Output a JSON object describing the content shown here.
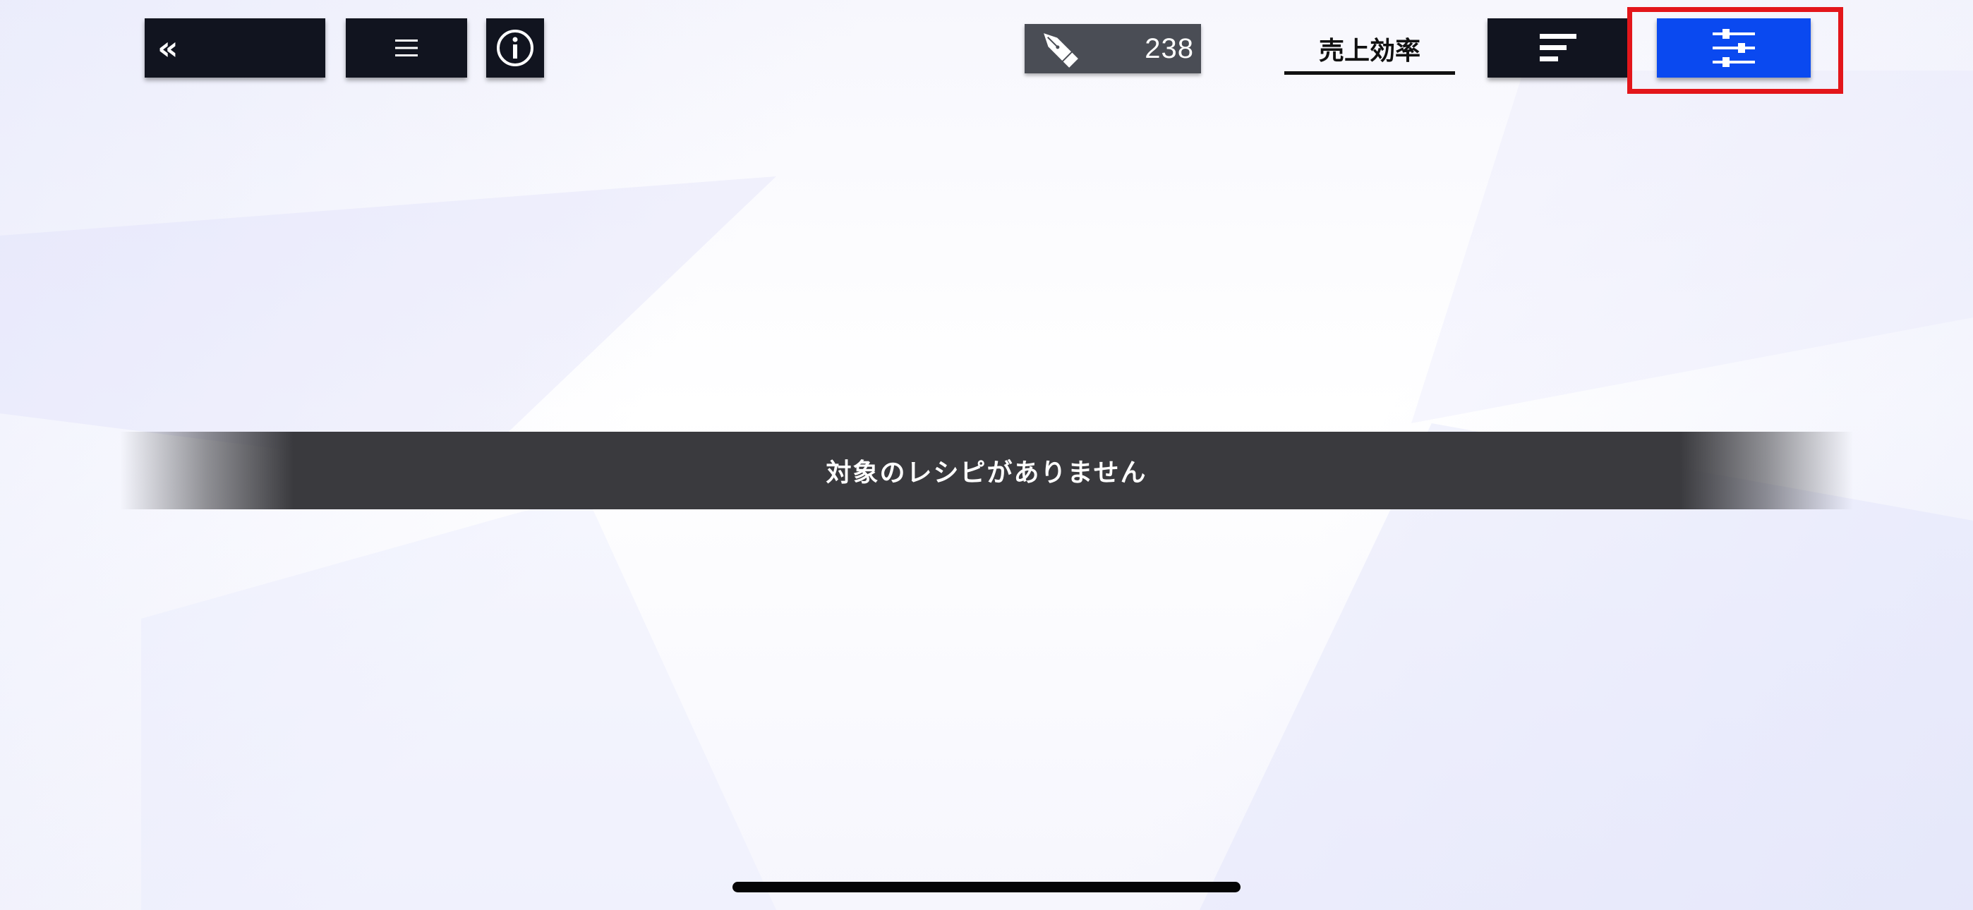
{
  "header": {
    "back_icon": "double-chevron-left-icon",
    "menu_icon": "hamburger-menu-icon",
    "info_icon": "info-icon",
    "counter": {
      "icon": "pen-nib-icon",
      "value": "238"
    },
    "sort_label": "売上効率",
    "sort_icon": "sort-lines-icon",
    "filter_icon": "sliders-icon"
  },
  "main": {
    "empty_message": "対象のレシピがありません"
  },
  "colors": {
    "button_dark": "#11141f",
    "filter_active": "#0a49f0",
    "highlight_border": "#e3161b",
    "banner_bg": "#3a3a3e"
  }
}
